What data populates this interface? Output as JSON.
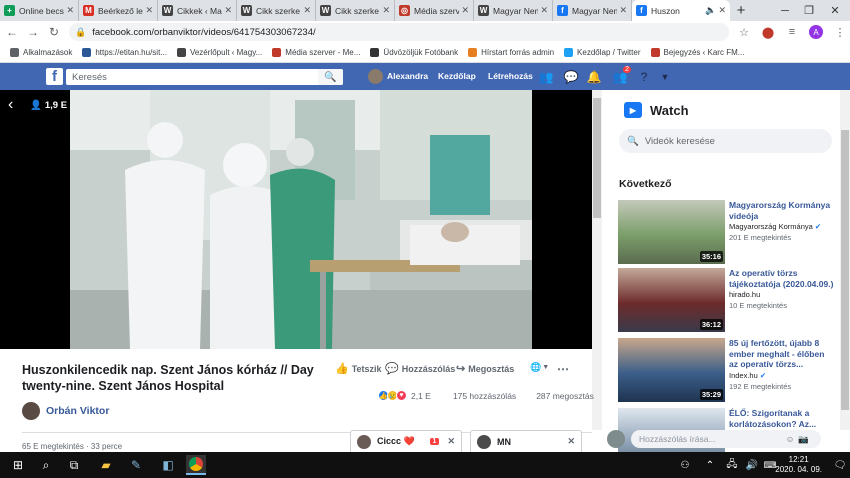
{
  "browser": {
    "tabs": [
      {
        "label": "Online becs",
        "color": "#0f9d58",
        "glyph": "+"
      },
      {
        "label": "Beérkező le",
        "color": "#d93025",
        "glyph": "M"
      },
      {
        "label": "Cikkek ‹ Ma",
        "color": "#444444",
        "glyph": "W"
      },
      {
        "label": "Cikk szerke",
        "color": "#444444",
        "glyph": "W"
      },
      {
        "label": "Cikk szerke",
        "color": "#444444",
        "glyph": "W"
      },
      {
        "label": "Média szerv",
        "color": "#c0392b",
        "glyph": "◎"
      },
      {
        "label": "Magyar Nem",
        "color": "#444444",
        "glyph": "W"
      },
      {
        "label": "Magyar Nem",
        "color": "#1877f2",
        "glyph": "f"
      },
      {
        "label": "Huszon",
        "color": "#1877f2",
        "glyph": "f",
        "active": true
      }
    ],
    "new_tab": "+",
    "url": "facebook.com/orbanviktor/videos/641754303067234/",
    "profile_initial": "A"
  },
  "bookmarks": [
    {
      "label": "Alkalmazások",
      "color": "#5f6368"
    },
    {
      "label": "https://etitan.hu/sit...",
      "color": "#2b5797"
    },
    {
      "label": "Vezérlőpult ‹ Magy...",
      "color": "#444444"
    },
    {
      "label": "Média szerver - Me...",
      "color": "#c0392b"
    },
    {
      "label": "Üdvözöljük Fotóbank",
      "color": "#333333"
    },
    {
      "label": "Hírstart forrás admin",
      "color": "#e67e22"
    },
    {
      "label": "Kezdőlap / Twitter",
      "color": "#1da1f2"
    },
    {
      "label": "Bejegyzés ‹ Karc FM...",
      "color": "#c0392b"
    }
  ],
  "fb": {
    "search_placeholder": "Keresés",
    "user": "Alexandra",
    "home": "Kezdőlap",
    "create": "Létrehozás",
    "notification_badge": "2"
  },
  "video": {
    "live_views": "1,9 E",
    "title": "Huszonkilencedik nap. Szent János kórház // Day twenty-nine. Szent János Hospital",
    "author": "Orbán Viktor",
    "like_label": "Tetszik",
    "comment_label": "Hozzászólás",
    "share_label": "Megosztás",
    "reactions_count": "2,1 E",
    "comments_count": "175 hozzászólás",
    "shares_count": "287 megosztás",
    "views_line": "65 E megtekintés · 33 perce"
  },
  "chats": [
    {
      "label": "Ciccc ❤️",
      "badge": "1"
    },
    {
      "label": "MN"
    }
  ],
  "watch": {
    "title": "Watch",
    "search_placeholder": "Videók keresése",
    "next_heading": "Következő",
    "items": [
      {
        "title": "Magyarország Kormánya videója",
        "source": "Magyarország Kormánya",
        "views": "201 E megtekintés",
        "duration": "35:16",
        "verified": true
      },
      {
        "title": "Az operatív törzs tájékoztatója (2020.04.09.)",
        "source": "hirado.hu",
        "views": "10 E megtekintés",
        "duration": "36:12",
        "verified": false
      },
      {
        "title": "85 új fertőzött, újabb 8 ember meghalt - élőben az operatív törzs...",
        "source": "Index.hu",
        "views": "192 E megtekintés",
        "duration": "35:29",
        "verified": true
      },
      {
        "title": "ÉLŐ: Szigorítanak a korlátozásokon? Az...",
        "source": "",
        "views": "",
        "duration": "",
        "verified": false
      }
    ],
    "comment_placeholder": "Hozzászólás írása..."
  },
  "taskbar": {
    "time": "12:21",
    "date": "2020. 04. 09."
  }
}
